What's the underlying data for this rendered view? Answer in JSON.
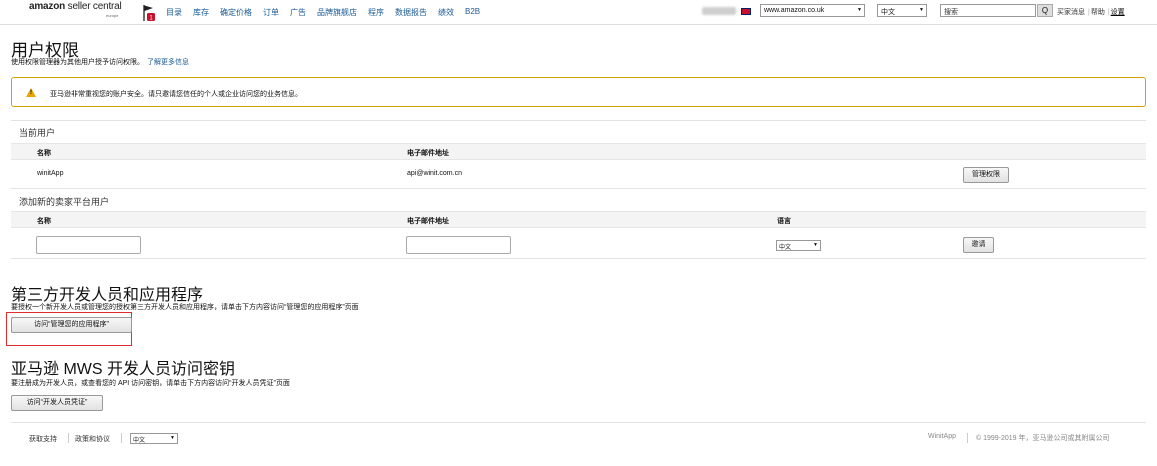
{
  "nav": {
    "logo": "amazon",
    "logo_suffix": "seller central",
    "logo_region": "europe",
    "notification_count": "1",
    "items": [
      "目录",
      "库存",
      "确定价格",
      "订单",
      "广告",
      "品牌旗舰店",
      "程序",
      "数据报告",
      "绩效",
      "B2B"
    ],
    "marketplace": "www.amazon.co.uk",
    "language": "中文",
    "search_placeholder": "搜索",
    "search_button": "Q",
    "links": [
      "买家消息",
      "帮助",
      "设置"
    ]
  },
  "page": {
    "title": "用户权限",
    "description": "使用权限管理器为其他用户授予访问权限。",
    "learn_more": "了解更多信息",
    "alert": "亚马逊非常重视您的账户安全。请只邀请您信任的个人或企业访问您的业务信息。"
  },
  "current_users": {
    "label": "当前用户",
    "col_name": "名称",
    "col_email": "电子邮件地址",
    "rows": [
      {
        "name": "winitApp",
        "email": "api@winit.com.cn",
        "action": "管理权限"
      }
    ]
  },
  "add_user": {
    "label": "添加新的卖家平台用户",
    "col_name": "名称",
    "col_email": "电子邮件地址",
    "col_lang": "语言",
    "lang_value": "中文",
    "invite_button": "邀请"
  },
  "third_party": {
    "title": "第三方开发人员和应用程序",
    "description": "要授权一个新开发人员或管理您的授权第三方开发人员和应用程序，请单击下方内容访问“管理您的应用程序”页面",
    "button": "访问“管理您的应用程序”"
  },
  "mws": {
    "title": "亚马逊 MWS 开发人员访问密钥",
    "description": "要注册成为开发人员，或查看您的 API 访问密钥，请单击下方内容访问“开发人员凭证”页面",
    "button": "访问“开发人员凭证”"
  },
  "footer": {
    "links": [
      "获取支持",
      "政策和协议"
    ],
    "language": "中文",
    "app_name": "WinitApp",
    "copyright": "© 1999-2019 年，亚马逊公司或其附属公司"
  }
}
